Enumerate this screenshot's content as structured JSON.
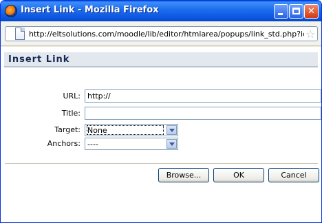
{
  "window": {
    "title": "Insert Link - Mozilla Firefox"
  },
  "address": {
    "url": "http://eltsolutions.com/moodle/lib/editor/htmlarea/popups/link_std.php?ic"
  },
  "dialog": {
    "heading": "Insert Link",
    "fields": {
      "url_label": "URL:",
      "url_value": "http://",
      "title_label": "Title:",
      "title_value": "",
      "target_label": "Target:",
      "target_value": "None",
      "anchors_label": "Anchors:",
      "anchors_value": "----"
    },
    "buttons": {
      "browse": "Browse...",
      "ok": "OK",
      "cancel": "Cancel"
    }
  },
  "icons": [
    "firefox-icon",
    "minimize-icon",
    "maximize-icon",
    "close-icon",
    "page-icon",
    "bookmark-star-icon",
    "dropdown-arrow-icon"
  ]
}
